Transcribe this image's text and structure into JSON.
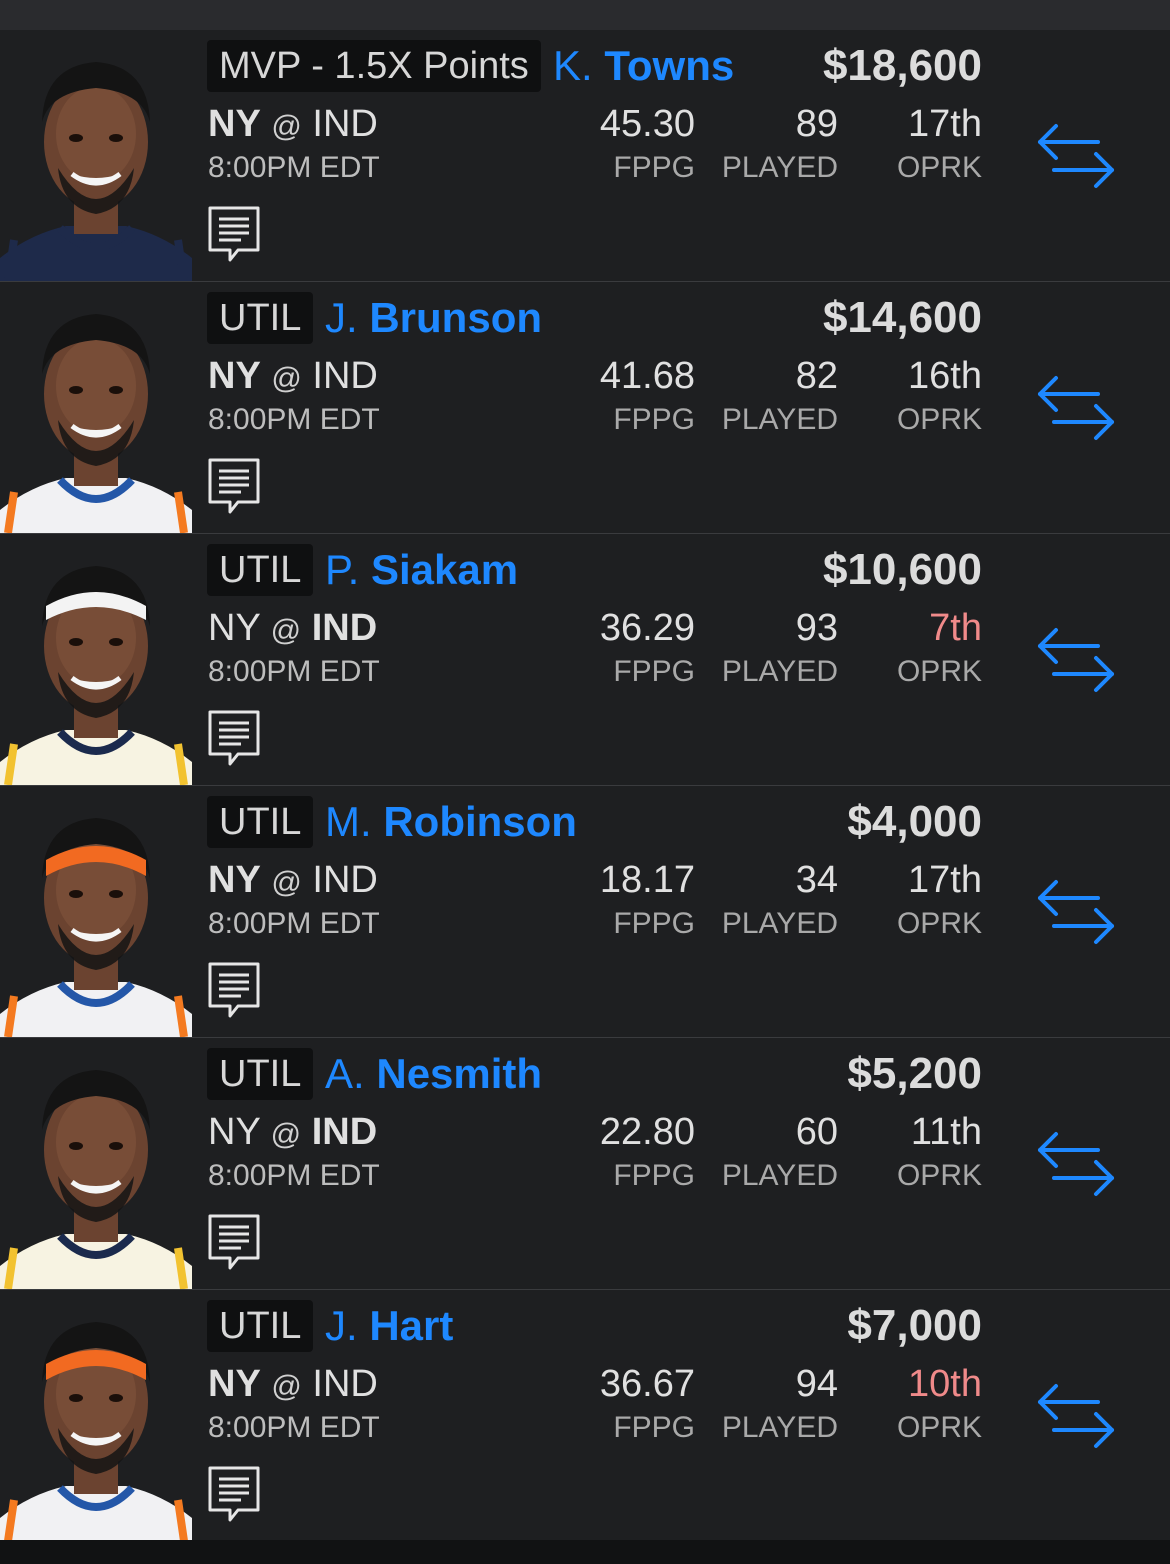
{
  "colors": {
    "accent": "#1e88ff",
    "background": "#1e1f21",
    "rank_hot": "#f08a8a"
  },
  "players": [
    {
      "position": "MVP - 1.5X Points",
      "first": "K.",
      "last": "Towns",
      "salary": "$18,600",
      "home_team": "NY",
      "at": "@",
      "away_team": "IND",
      "bold_team": "home",
      "time": "8:00PM EDT",
      "fppg": "45.30",
      "fppg_label": "FPPG",
      "played": "89",
      "played_label": "PLAYED",
      "oprk": "17th",
      "oprk_label": "OPRK",
      "oprk_hot": false,
      "jersey": "navy",
      "headband": "none"
    },
    {
      "position": "UTIL",
      "first": "J.",
      "last": "Brunson",
      "salary": "$14,600",
      "home_team": "NY",
      "at": "@",
      "away_team": "IND",
      "bold_team": "home",
      "time": "8:00PM EDT",
      "fppg": "41.68",
      "fppg_label": "FPPG",
      "played": "82",
      "played_label": "PLAYED",
      "oprk": "16th",
      "oprk_label": "OPRK",
      "oprk_hot": false,
      "jersey": "knicks",
      "headband": "none"
    },
    {
      "position": "UTIL",
      "first": "P.",
      "last": "Siakam",
      "salary": "$10,600",
      "home_team": "NY",
      "at": "@",
      "away_team": "IND",
      "bold_team": "away",
      "time": "8:00PM EDT",
      "fppg": "36.29",
      "fppg_label": "FPPG",
      "played": "93",
      "played_label": "PLAYED",
      "oprk": "7th",
      "oprk_label": "OPRK",
      "oprk_hot": true,
      "jersey": "pacers",
      "headband": "white"
    },
    {
      "position": "UTIL",
      "first": "M.",
      "last": "Robinson",
      "salary": "$4,000",
      "home_team": "NY",
      "at": "@",
      "away_team": "IND",
      "bold_team": "home",
      "time": "8:00PM EDT",
      "fppg": "18.17",
      "fppg_label": "FPPG",
      "played": "34",
      "played_label": "PLAYED",
      "oprk": "17th",
      "oprk_label": "OPRK",
      "oprk_hot": false,
      "jersey": "knicks",
      "headband": "orange"
    },
    {
      "position": "UTIL",
      "first": "A.",
      "last": "Nesmith",
      "salary": "$5,200",
      "home_team": "NY",
      "at": "@",
      "away_team": "IND",
      "bold_team": "away",
      "time": "8:00PM EDT",
      "fppg": "22.80",
      "fppg_label": "FPPG",
      "played": "60",
      "played_label": "PLAYED",
      "oprk": "11th",
      "oprk_label": "OPRK",
      "oprk_hot": false,
      "jersey": "pacers",
      "headband": "none"
    },
    {
      "position": "UTIL",
      "first": "J.",
      "last": "Hart",
      "salary": "$7,000",
      "home_team": "NY",
      "at": "@",
      "away_team": "IND",
      "bold_team": "home",
      "time": "8:00PM EDT",
      "fppg": "36.67",
      "fppg_label": "FPPG",
      "played": "94",
      "played_label": "PLAYED",
      "oprk": "10th",
      "oprk_label": "OPRK",
      "oprk_hot": true,
      "jersey": "knicks",
      "headband": "orange"
    }
  ]
}
